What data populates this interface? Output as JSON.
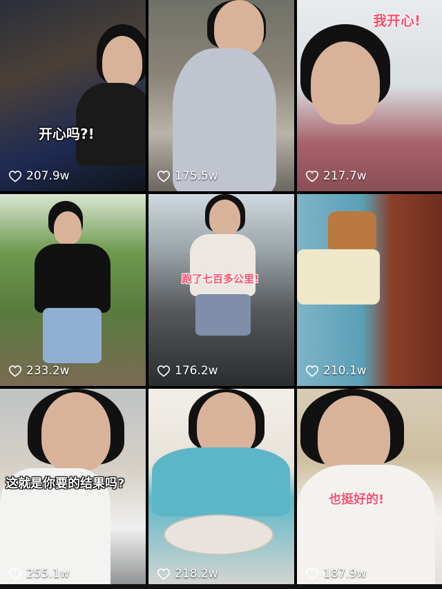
{
  "videos": [
    {
      "likes": "207.9w",
      "caption": "开心吗?!"
    },
    {
      "likes": "175.5w",
      "caption": ""
    },
    {
      "likes": "217.7w",
      "caption": "我开心!"
    },
    {
      "likes": "233.2w",
      "caption": ""
    },
    {
      "likes": "176.2w",
      "caption": "跑了七百多公里!"
    },
    {
      "likes": "210.1w",
      "caption": ""
    },
    {
      "likes": "255.1w",
      "caption": "这就是你要的结果吗?"
    },
    {
      "likes": "218.2w",
      "caption": ""
    },
    {
      "likes": "187.9w",
      "caption": "也挺好的!"
    }
  ],
  "icons": {
    "like": "heart-outline-icon"
  }
}
